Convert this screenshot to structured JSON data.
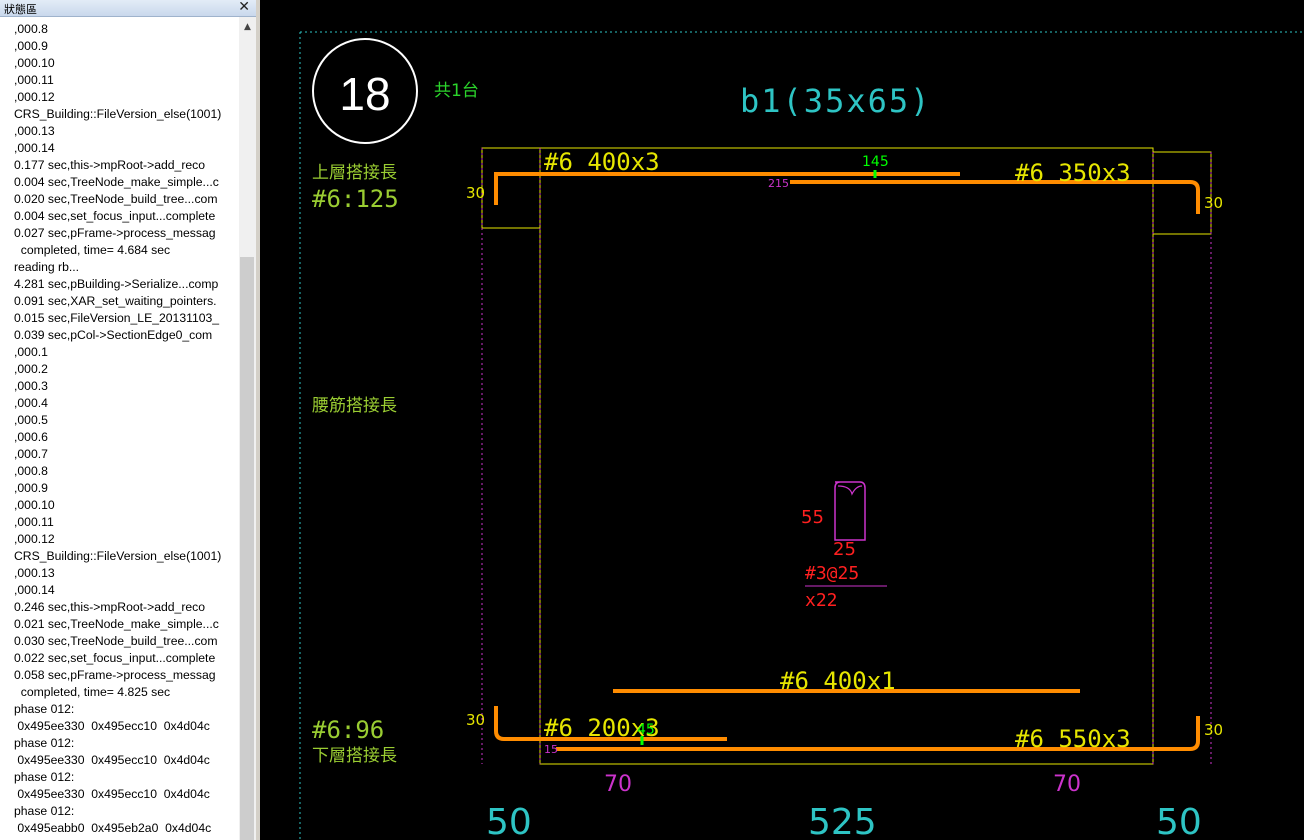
{
  "status_panel": {
    "title": "狀態區",
    "close_glyph": "✕",
    "log_lines": [
      ",000.8",
      ",000.9",
      ",000.10",
      ",000.11",
      ",000.12",
      "CRS_Building::FileVersion_else(1001)",
      ",000.13",
      ",000.14",
      "0.177 sec,this->mpRoot->add_reco",
      "0.004 sec,TreeNode_make_simple...c",
      "0.020 sec,TreeNode_build_tree...com",
      "0.004 sec,set_focus_input...complete",
      "0.027 sec,pFrame->process_messag",
      "  completed, time= 4.684 sec",
      "reading rb...",
      "4.281 sec,pBuilding->Serialize...comp",
      "0.091 sec,XAR_set_waiting_pointers.",
      "0.015 sec,FileVersion_LE_20131103_",
      "0.039 sec,pCol->SectionEdge0_com",
      ",000.1",
      ",000.2",
      ",000.3",
      ",000.4",
      ",000.5",
      ",000.6",
      ",000.7",
      ",000.8",
      ",000.9",
      ",000.10",
      ",000.11",
      ",000.12",
      "CRS_Building::FileVersion_else(1001)",
      ",000.13",
      ",000.14",
      "0.246 sec,this->mpRoot->add_reco",
      "0.021 sec,TreeNode_make_simple...c",
      "0.030 sec,TreeNode_build_tree...com",
      "0.022 sec,set_focus_input...complete",
      "0.058 sec,pFrame->process_messag",
      "  completed, time= 4.825 sec",
      "phase 012:",
      " 0x495ee330  0x495ecc10  0x4d04c",
      "phase 012:",
      " 0x495ee330  0x495ecc10  0x4d04c",
      "phase 012:",
      " 0x495ee330  0x495ecc10  0x4d04c",
      "phase 012:",
      " 0x495eabb0  0x495eb2a0  0x4d04c"
    ]
  },
  "drawing": {
    "beam_number": "18",
    "quantity_label": "共1台",
    "beam_title": "b1(35x65)",
    "top_lap_label": "上層搭接長",
    "top_lap_value": "#6:125",
    "web_lap_label": "腰筋搭接長",
    "bottom_lap_value": "#6:96",
    "bottom_lap_label": "下層搭接長",
    "top_left_bar": "#6 400x3",
    "top_right_bar": "#6 350x3",
    "top_mid_dim": "145",
    "top_offset_dim": "215",
    "hook_top_left": "30",
    "hook_top_right": "30",
    "bottom_mid_bar": "#6 400x1",
    "bottom_left_bar": "#6 200x3",
    "bottom_right_bar": "#6 550x3",
    "bottom_mid_dim": "45",
    "bottom_offset_dim": "15",
    "hook_bottom_left": "30",
    "hook_bottom_right": "30",
    "stirrup_height": "55",
    "stirrup_width": "25",
    "stirrup_spec": "#3@25",
    "stirrup_count": "x22",
    "support_left": "70",
    "support_right": "70",
    "span_left": "50",
    "span_mid": "525",
    "span_right": "50",
    "colors": {
      "rebar": "#ff8c00",
      "yellow": "#e6e600",
      "cyan": "#2ec4c4",
      "lime": "#9acd32",
      "magenta": "#cc33cc",
      "red": "#ff2020",
      "green": "#00ff00"
    }
  }
}
